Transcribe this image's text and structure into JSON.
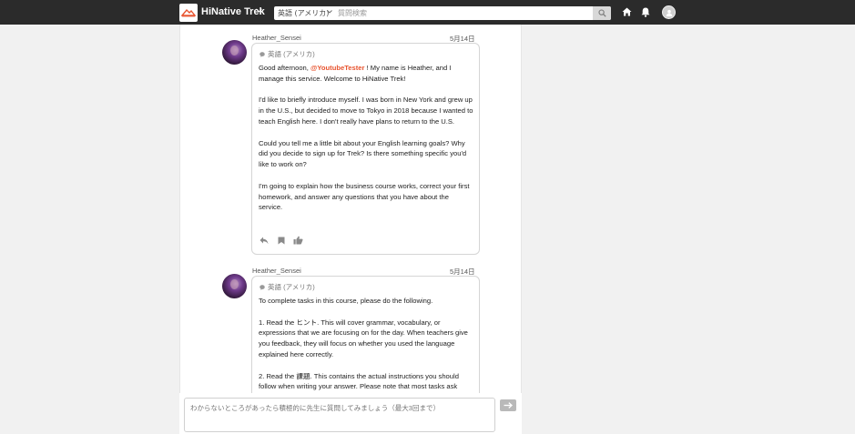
{
  "header": {
    "brand": "HiNative Trek",
    "search_language": "英語 (アメリカ)",
    "search_placeholder": "質問検索",
    "icons": [
      "logo-icon",
      "chevron-down-icon",
      "search-icon",
      "home-icon",
      "bell-icon",
      "avatar-icon"
    ]
  },
  "messages": [
    {
      "author": "Heather_Sensei",
      "date": "5月14日",
      "language": "英語 (アメリカ)",
      "p1_pre": "Good afternoon, ",
      "p1_mention": "@YoutubeTester",
      "p1_post": " ! My name is Heather, and I manage this service. Welcome to HiNative Trek!",
      "p2": "I'd like to briefly introduce myself. I was born in New York and grew up in the U.S., but decided to move to Tokyo in 2018 because I wanted to teach English here. I don't really have plans to return to the U.S.",
      "p3": "Could you tell me a little bit about your English learning goals? Why did you decide to sign up for Trek? Is there something specific you'd like to work on?",
      "p4": "I'm going to explain how the business course works, correct your first homework, and answer any questions that you have about the service.",
      "actions": [
        "reply-icon",
        "bookmark-icon",
        "like-icon"
      ]
    },
    {
      "author": "Heather_Sensei",
      "date": "5月14日",
      "language": "英語 (アメリカ)",
      "p1": "To complete tasks in this course, please do the following.",
      "p2": "1. Read the ヒント. This will cover grammar, vocabulary, or expressions that we are focusing on for the day. When teachers give you feedback, they will focus on whether you used the language explained here correctly.",
      "p3": "2. Read the 課題. This contains the actual instructions you should follow when writing your answer. Please note that most tasks ask"
    }
  ],
  "compose": {
    "placeholder": "わからないところがあったら積極的に先生に質問してみましょう（最大3回まで）"
  },
  "colors": {
    "topbar": "#2b2b2b",
    "mention": "#e8542f",
    "logo": "#e8542f"
  }
}
